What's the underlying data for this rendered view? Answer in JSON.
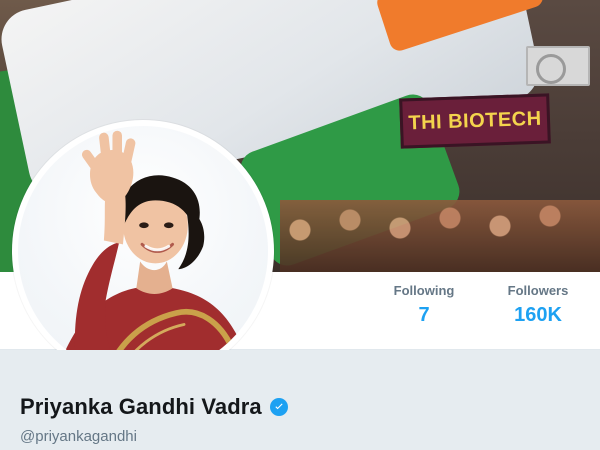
{
  "banner": {
    "sign_text": "THI BIOTECH"
  },
  "profile": {
    "display_name": "Priyanka Gandhi Vadra",
    "handle": "@priyankagandhi",
    "verified": true
  },
  "stats": [
    {
      "label": "Following",
      "value": "7"
    },
    {
      "label": "Followers",
      "value": "160K"
    }
  ],
  "colors": {
    "link_blue": "#1da1f2",
    "muted_gray": "#657786",
    "text_dark": "#14171a"
  },
  "icons": {
    "verified": "verified-badge-icon"
  }
}
